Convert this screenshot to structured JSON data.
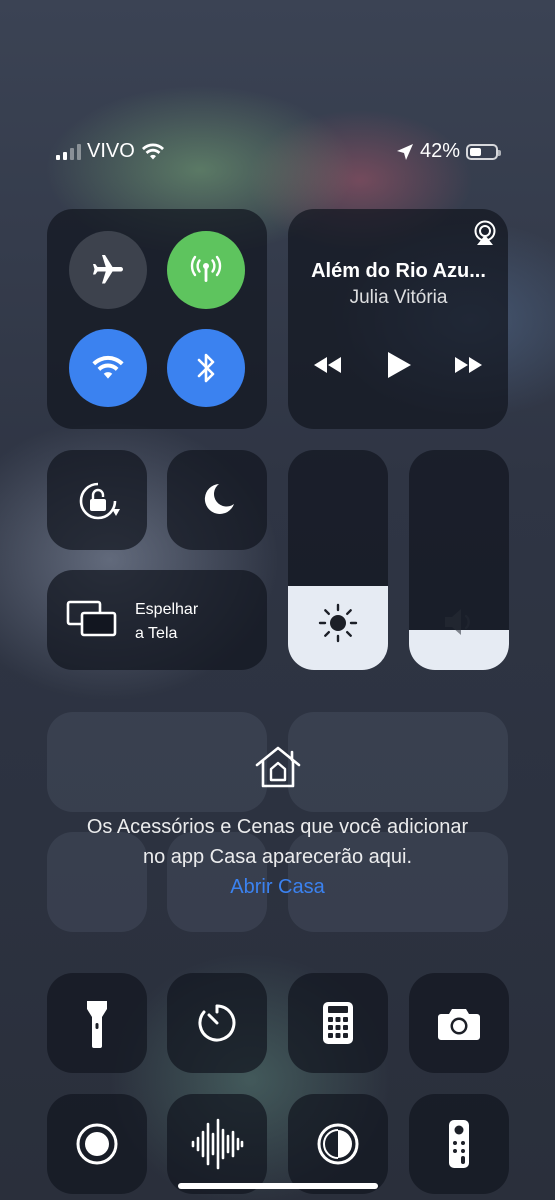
{
  "status": {
    "carrier": "VIVO",
    "battery": "42%",
    "signal_bars": 2
  },
  "connectivity": {
    "airplane": {
      "icon": "airplane-icon",
      "on": false
    },
    "cellular": {
      "icon": "antenna-icon",
      "on": true,
      "color": "#5ec45e"
    },
    "wifi": {
      "icon": "wifi-icon",
      "on": true,
      "color": "#3b82f0"
    },
    "bluetooth": {
      "icon": "bluetooth-icon",
      "on": true,
      "color": "#3b82f0"
    }
  },
  "now_playing": {
    "title": "Além do Rio Azu...",
    "artist": "Julia Vitória"
  },
  "screen_mirroring": {
    "line1": "Espelhar",
    "line2": "a Tela"
  },
  "brightness": {
    "level": 0.38
  },
  "volume": {
    "level": 0.18
  },
  "home": {
    "message_line1": "Os Acessórios e Cenas que você adicionar",
    "message_line2": "no app Casa aparecerão aqui.",
    "link": "Abrir Casa"
  },
  "controls": [
    "flashlight-icon",
    "timer-icon",
    "calculator-icon",
    "camera-icon",
    "screen-record-icon",
    "voice-memo-icon",
    "dark-mode-icon",
    "apple-tv-remote-icon"
  ]
}
